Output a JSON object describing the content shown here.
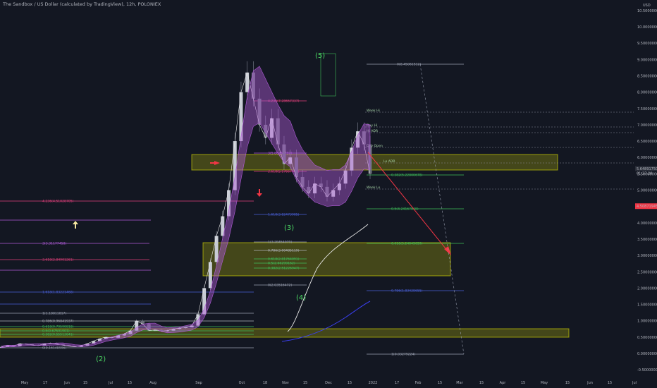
{
  "header": {
    "title": "The Sandbox / US Dollar (calculated by TradingView), 12h, POLONIEX"
  },
  "chart_data": {
    "type": "line",
    "currency": "USD",
    "y_ticks": [
      "10.50000000",
      "10.00000000",
      "9.50000000",
      "9.00000000",
      "8.50000000",
      "8.00000000",
      "7.50000000",
      "7.00000000",
      "6.50000000",
      "6.00000000",
      "5.50000000",
      "5.00000000",
      "4.50000000",
      "4.00000000",
      "3.50000000",
      "3.00000000",
      "2.50000000",
      "2.00000000",
      "1.50000000",
      "1.00000000",
      "0.50000000",
      "0.00000000",
      "-0.50000000"
    ],
    "x_ticks": [
      "May",
      "17",
      "Jun",
      "15",
      "Jul",
      "15",
      "Aug",
      "Sep",
      "Oct",
      "18",
      "Nov",
      "15",
      "Dec",
      "15",
      "2022",
      "17",
      "Feb",
      "15",
      "Mar",
      "15",
      "Apr",
      "15",
      "May",
      "15",
      "Jun",
      "15",
      "Jul"
    ],
    "price_labels": {
      "current": "4.50871945",
      "top_a": "5.64891750",
      "top_b": "01:37:20"
    },
    "price_series": [
      0.2,
      0.25,
      0.22,
      0.3,
      0.28,
      0.26,
      0.24,
      0.3,
      0.32,
      0.28,
      0.25,
      0.22,
      0.2,
      0.24,
      0.3,
      0.38,
      0.45,
      0.5,
      0.48,
      0.55,
      0.6,
      0.7,
      1.0,
      0.9,
      0.7,
      0.72,
      0.68,
      0.7,
      0.75,
      0.78,
      0.8,
      0.85,
      1.2,
      2.0,
      2.8,
      3.6,
      4.2,
      5.0,
      6.5,
      8.0,
      8.6,
      7.8,
      7.0,
      6.6,
      7.2,
      6.4,
      5.8,
      6.0,
      5.4,
      5.1,
      4.9,
      5.2,
      5.1,
      4.8,
      5.0,
      5.2,
      5.6,
      6.3,
      6.8,
      6.4,
      5.5
    ],
    "waves": [
      "(2)",
      "(3)",
      "(4)",
      "(5)"
    ],
    "fib_levels_left": [
      "4.236(4.51028705)",
      "3.618(2.84901261)",
      "3(3.31177458)",
      "1.618(1.83221468)",
      "1(1.18811817)",
      "0.786(0.96841937)",
      "0.618(0.79590818)",
      "0.5(0.67591901)",
      "0.382(0.55513841)",
      "0(0.16148996)"
    ],
    "fib_levels_mid": [
      "4.236(7.28657337)",
      "3(5.86250797)",
      "2.618(5.17667065)",
      "1.618(3.82473985)",
      "1(3.28454079)",
      "0.786(3.00485119)",
      "0.618(2.81764091)",
      "0.5(2.66299162)",
      "0.382(2.51226947)",
      "0(2.03516472)"
    ],
    "fib_levels_right": [
      "0(8.45061512)",
      "0.382(5.22800678)",
      "0.5(4.24167838)",
      "0.618(3.24845059)",
      "0.786(1.83428655)",
      "1(0.03279224)"
    ],
    "session_labels": [
      "Week Hi",
      "Day Hi",
      "Hi ADR",
      "Day Open",
      "Lo ADR",
      "Week Lo"
    ],
    "colors": {
      "background": "#131722",
      "zone_fill": "#f6f600",
      "arrow": "#f23645",
      "fib_green": "#3fbf5a",
      "fib_purple": "#b05bd8",
      "fib_blue": "#4a60d8",
      "fib_pink": "#e0407b",
      "ma_white": "#e8e8e8",
      "ma_blue": "#3a3ff0"
    }
  }
}
